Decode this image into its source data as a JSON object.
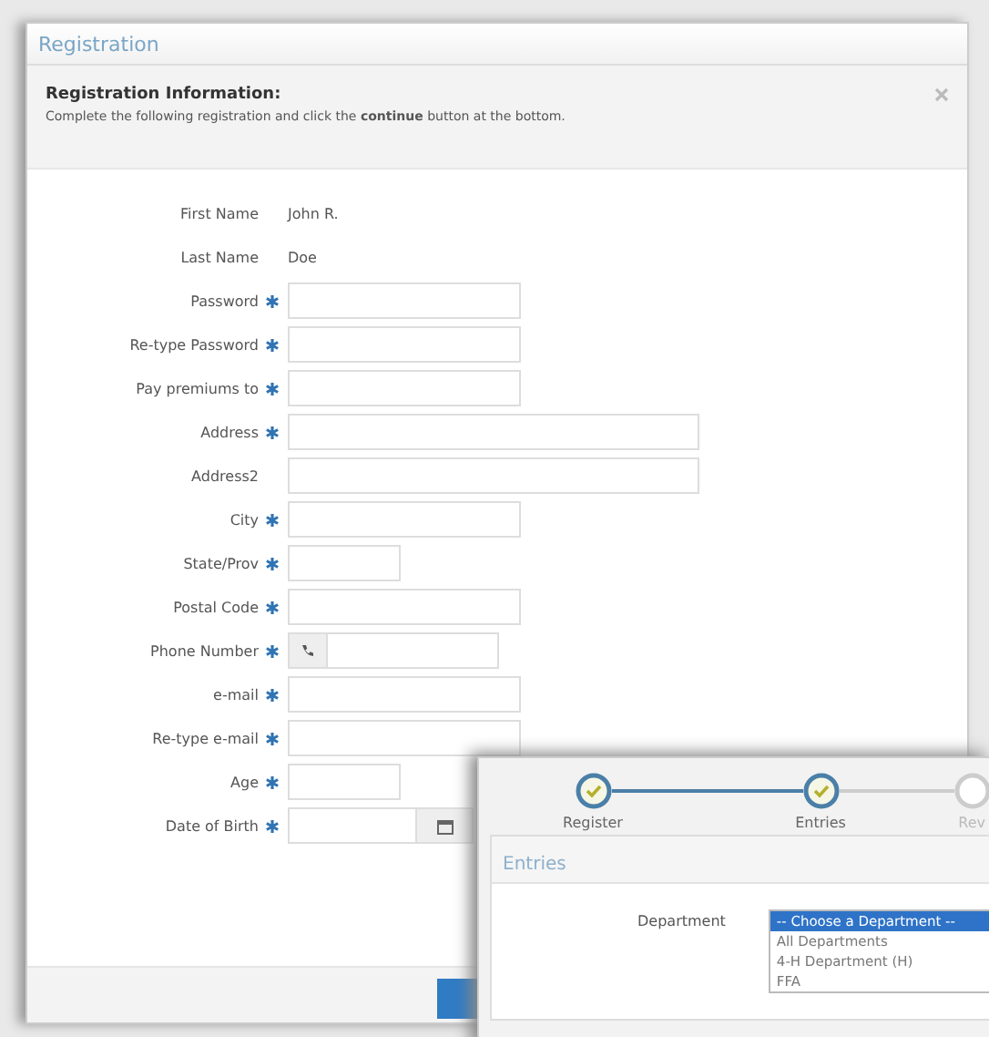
{
  "window": {
    "title": "Registration"
  },
  "info": {
    "heading": "Registration Information:",
    "text": "Complete the following registration and click the **continue** button at the bottom."
  },
  "fields": [
    {
      "label": "First Name",
      "kind": "text",
      "value": "John R.",
      "required": false
    },
    {
      "label": "Last Name",
      "kind": "text",
      "value": "Doe",
      "required": false
    },
    {
      "label": "Password",
      "kind": "medium",
      "required": true
    },
    {
      "label": "Re-type Password",
      "kind": "medium",
      "required": true
    },
    {
      "label": "Pay premiums to",
      "kind": "medium",
      "required": true
    },
    {
      "label": "Address",
      "kind": "long",
      "required": true
    },
    {
      "label": "Address2",
      "kind": "long",
      "required": false
    },
    {
      "label": "City",
      "kind": "medium",
      "required": true
    },
    {
      "label": "State/Prov",
      "kind": "short",
      "required": true
    },
    {
      "label": "Postal Code",
      "kind": "medium",
      "required": true
    },
    {
      "label": "Phone Number",
      "kind": "phone",
      "required": true
    },
    {
      "label": "e-mail",
      "kind": "medium",
      "required": true
    },
    {
      "label": "Re-type e-mail",
      "kind": "medium",
      "required": true
    },
    {
      "label": "Age",
      "kind": "short",
      "required": true
    },
    {
      "label": "Date of Birth",
      "kind": "date",
      "required": true
    }
  ],
  "wizard": {
    "steps": [
      {
        "label": "Register",
        "done": true
      },
      {
        "label": "Entries",
        "done": true
      },
      {
        "label": "Rev",
        "done": false
      }
    ],
    "panel_title": "Entries",
    "department_label": "Department",
    "department_options": [
      {
        "label": "-- Choose a Department --",
        "selected": true
      },
      {
        "label": "All Departments",
        "selected": false
      },
      {
        "label": "4-H Department (H)",
        "selected": false
      },
      {
        "label": "FFA",
        "selected": false
      }
    ]
  }
}
